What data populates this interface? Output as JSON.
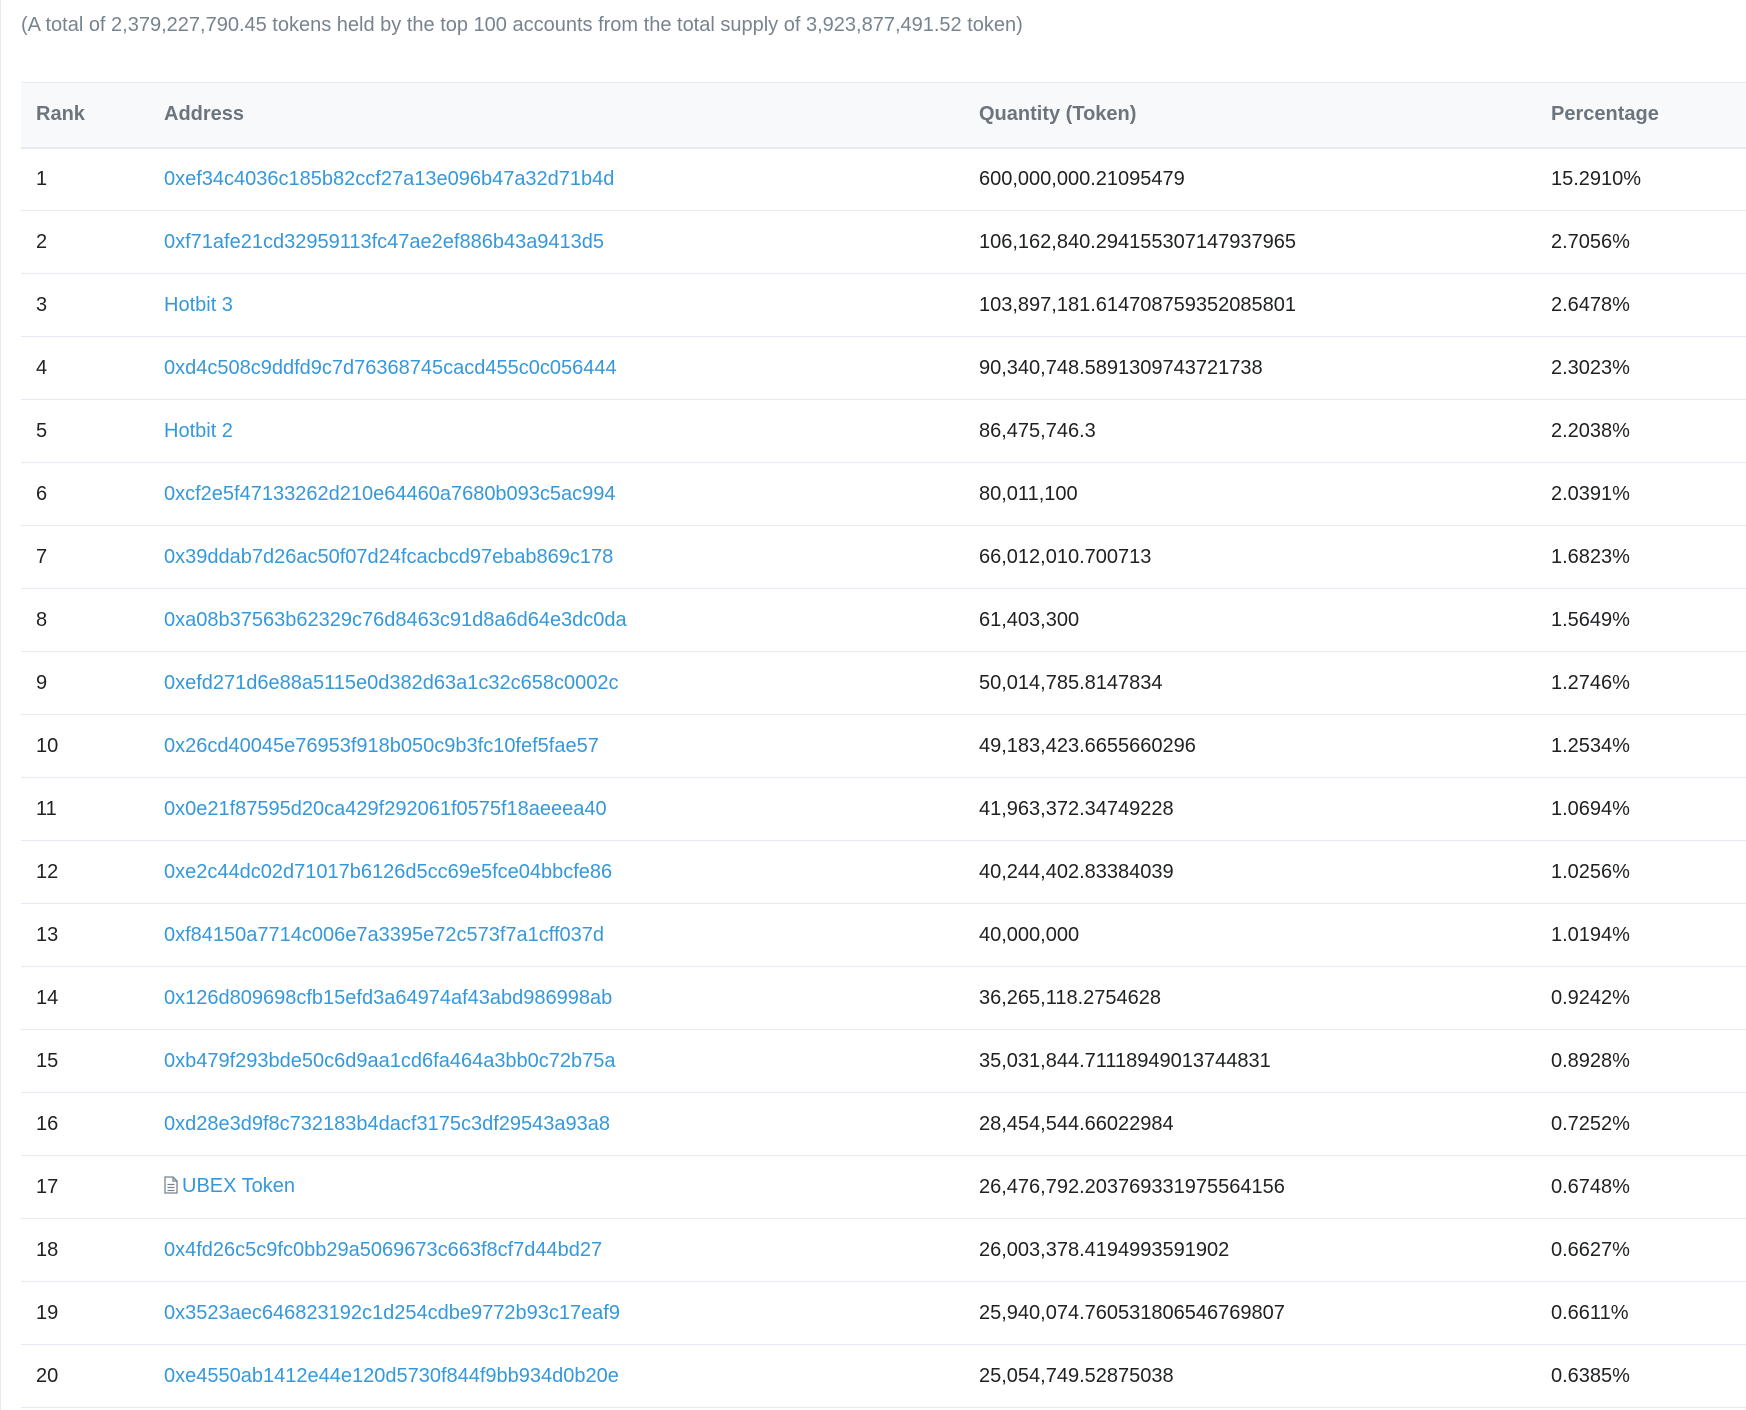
{
  "summary_text": "(A total of 2,379,227,790.45 tokens held by the top 100 accounts from the total supply of 3,923,877,491.52 token)",
  "columns": {
    "rank": "Rank",
    "address": "Address",
    "quantity": "Quantity (Token)",
    "percentage": "Percentage"
  },
  "rows": [
    {
      "rank": "1",
      "address": "0xef34c4036c185b82ccf27a13e096b47a32d71b4d",
      "quantity": "600,000,000.21095479",
      "percentage": "15.2910%",
      "is_contract": false
    },
    {
      "rank": "2",
      "address": "0xf71afe21cd32959113fc47ae2ef886b43a9413d5",
      "quantity": "106,162,840.294155307147937965",
      "percentage": "2.7056%",
      "is_contract": false
    },
    {
      "rank": "3",
      "address": "Hotbit 3",
      "quantity": "103,897,181.614708759352085801",
      "percentage": "2.6478%",
      "is_contract": false
    },
    {
      "rank": "4",
      "address": "0xd4c508c9ddfd9c7d76368745cacd455c0c056444",
      "quantity": "90,340,748.5891309743721738",
      "percentage": "2.3023%",
      "is_contract": false
    },
    {
      "rank": "5",
      "address": "Hotbit 2",
      "quantity": "86,475,746.3",
      "percentage": "2.2038%",
      "is_contract": false
    },
    {
      "rank": "6",
      "address": "0xcf2e5f47133262d210e64460a7680b093c5ac994",
      "quantity": "80,011,100",
      "percentage": "2.0391%",
      "is_contract": false
    },
    {
      "rank": "7",
      "address": "0x39ddab7d26ac50f07d24fcacbcd97ebab869c178",
      "quantity": "66,012,010.700713",
      "percentage": "1.6823%",
      "is_contract": false
    },
    {
      "rank": "8",
      "address": "0xa08b37563b62329c76d8463c91d8a6d64e3dc0da",
      "quantity": "61,403,300",
      "percentage": "1.5649%",
      "is_contract": false
    },
    {
      "rank": "9",
      "address": "0xefd271d6e88a5115e0d382d63a1c32c658c0002c",
      "quantity": "50,014,785.8147834",
      "percentage": "1.2746%",
      "is_contract": false
    },
    {
      "rank": "10",
      "address": "0x26cd40045e76953f918b050c9b3fc10fef5fae57",
      "quantity": "49,183,423.6655660296",
      "percentage": "1.2534%",
      "is_contract": false
    },
    {
      "rank": "11",
      "address": "0x0e21f87595d20ca429f292061f0575f18aeeea40",
      "quantity": "41,963,372.34749228",
      "percentage": "1.0694%",
      "is_contract": false
    },
    {
      "rank": "12",
      "address": "0xe2c44dc02d71017b6126d5cc69e5fce04bbcfe86",
      "quantity": "40,244,402.83384039",
      "percentage": "1.0256%",
      "is_contract": false
    },
    {
      "rank": "13",
      "address": "0xf84150a7714c006e7a3395e72c573f7a1cff037d",
      "quantity": "40,000,000",
      "percentage": "1.0194%",
      "is_contract": false
    },
    {
      "rank": "14",
      "address": "0x126d809698cfb15efd3a64974af43abd986998ab",
      "quantity": "36,265,118.2754628",
      "percentage": "0.9242%",
      "is_contract": false
    },
    {
      "rank": "15",
      "address": "0xb479f293bde50c6d9aa1cd6fa464a3bb0c72b75a",
      "quantity": "35,031,844.71118949013744831",
      "percentage": "0.8928%",
      "is_contract": false
    },
    {
      "rank": "16",
      "address": "0xd28e3d9f8c732183b4dacf3175c3df29543a93a8",
      "quantity": "28,454,544.66022984",
      "percentage": "0.7252%",
      "is_contract": false
    },
    {
      "rank": "17",
      "address": "UBEX Token",
      "quantity": "26,476,792.203769331975564156",
      "percentage": "0.6748%",
      "is_contract": true,
      "icon": "contract-document-icon"
    },
    {
      "rank": "18",
      "address": "0x4fd26c5c9fc0bb29a5069673c663f8cf7d44bd27",
      "quantity": "26,003,378.4194993591902",
      "percentage": "0.6627%",
      "is_contract": false
    },
    {
      "rank": "19",
      "address": "0x3523aec646823192c1d254cdbe9772b93c17eaf9",
      "quantity": "25,940,074.760531806546769807",
      "percentage": "0.6611%",
      "is_contract": false
    },
    {
      "rank": "20",
      "address": "0xe4550ab1412e44e120d5730f844f9bb934d0b20e",
      "quantity": "25,054,749.52875038",
      "percentage": "0.6385%",
      "is_contract": false
    }
  ],
  "colors": {
    "link": "#3498db",
    "text": "#1e2022",
    "muted": "#77838f",
    "header_text": "#6c757e",
    "border": "#e7eaf3",
    "header_bg": "#f8f9fb"
  }
}
